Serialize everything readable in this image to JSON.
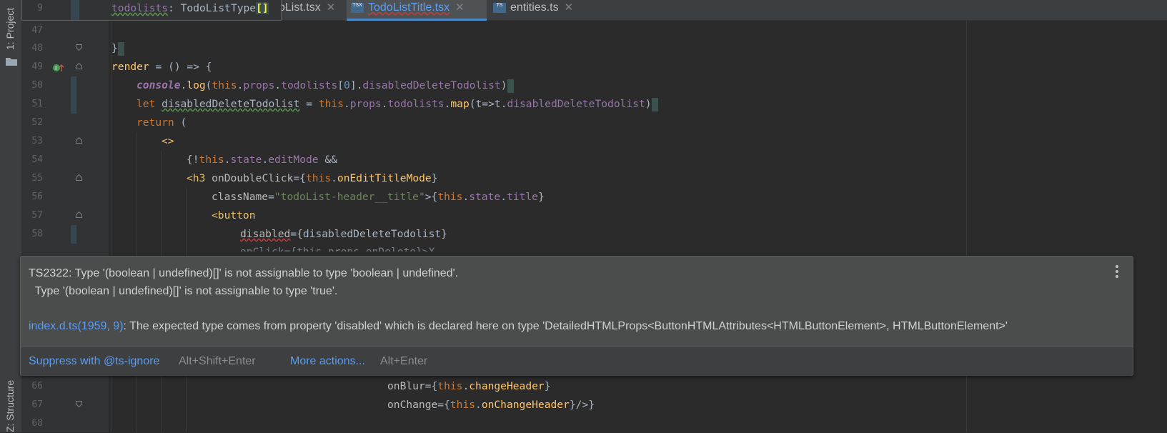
{
  "toolwindows": {
    "project": "1: Project",
    "structure": "Z: Structure"
  },
  "tabs": [
    {
      "label": "oList.tsx",
      "type": "",
      "active": false
    },
    {
      "label": "TodoListTitle.tsx",
      "type": "TSX",
      "active": true
    },
    {
      "label": "entities.ts",
      "type": "TS",
      "active": false
    }
  ],
  "sticky": {
    "line": "9",
    "text_name": "todolists",
    "text_rest": ": TodoListType",
    "brackets": "[]"
  },
  "lines": {
    "47": "47",
    "48": "48",
    "49": "49",
    "50": "50",
    "51": "51",
    "52": "52",
    "53": "53",
    "54": "54",
    "55": "55",
    "56": "56",
    "57": "57",
    "58": "58",
    "66": "66",
    "67": "67",
    "68": "68"
  },
  "code": {
    "l48": "}",
    "l49_a": "render",
    "l49_b": " = () => {",
    "l50_a": "console",
    "l50_b": ".",
    "l50_c": "log",
    "l50_d": "(",
    "l50_e": "this",
    "l50_f": ".",
    "l50_g": "props",
    "l50_h": ".",
    "l50_i": "todolists",
    "l50_j": "[",
    "l50_k": "0",
    "l50_l": "].",
    "l50_m": "disabledDeleteTodolist",
    "l50_n": ")",
    "l51_a": "let ",
    "l51_b": "disabledDeleteTodolist",
    "l51_c": " = ",
    "l51_d": "this",
    "l51_e": ".",
    "l51_f": "props",
    "l51_g": ".",
    "l51_h": "todolists",
    "l51_i": ".",
    "l51_j": "map",
    "l51_k": "(t=>t.",
    "l51_l": "disabledDeleteTodolist",
    "l51_m": ")",
    "l52_a": "return",
    "l52_b": " (",
    "l53": "<>",
    "l54_a": "{!",
    "l54_b": "this",
    "l54_c": ".",
    "l54_d": "state",
    "l54_e": ".",
    "l54_f": "editMode",
    "l54_g": " &&",
    "l55_a": "<h3 ",
    "l55_b": "onDoubleClick",
    "l55_c": "={",
    "l55_d": "this",
    "l55_e": ".",
    "l55_f": "onEditTitleMode",
    "l55_g": "}",
    "l56_a": "className",
    "l56_b": "=",
    "l56_c": "\"todoList-header__title\"",
    "l56_d": ">{",
    "l56_e": "this",
    "l56_f": ".",
    "l56_g": "state",
    "l56_h": ".",
    "l56_i": "title",
    "l56_j": "}",
    "l57": "<button",
    "l58_a": "disabled",
    "l58_b": "={disabledDeleteTodolist}",
    "l59_partial": "onClick={this.props.onDelete}>X",
    "l66_a": "onBlur",
    "l66_b": "={",
    "l66_c": "this",
    "l66_d": ".",
    "l66_e": "changeHeader",
    "l66_f": "}",
    "l67_a": "onChange",
    "l67_b": "={",
    "l67_c": "this",
    "l67_d": ".",
    "l67_e": "onChangeHeader",
    "l67_f": "}/>}"
  },
  "popup": {
    "line1": "TS2322: Type '(boolean | undefined)[]' is not assignable to type 'boolean | undefined'.",
    "line2": "  Type '(boolean | undefined)[]' is not assignable to type 'true'.",
    "link": "index.d.ts(1959, 9)",
    "line3": ": The expected type comes from property 'disabled' which is declared here on type 'DetailedHTMLProps<ButtonHTMLAttributes<HTMLButtonElement>, HTMLButtonElement>'",
    "action1": "Suppress with @ts-ignore",
    "shortcut1": "Alt+Shift+Enter",
    "action2": "More actions...",
    "shortcut2": "Alt+Enter"
  },
  "colors": {
    "keyword": "#cc7832",
    "property": "#9876aa",
    "function": "#ffc66d",
    "string": "#6a8759",
    "number": "#6897bb",
    "link": "#589df6"
  }
}
